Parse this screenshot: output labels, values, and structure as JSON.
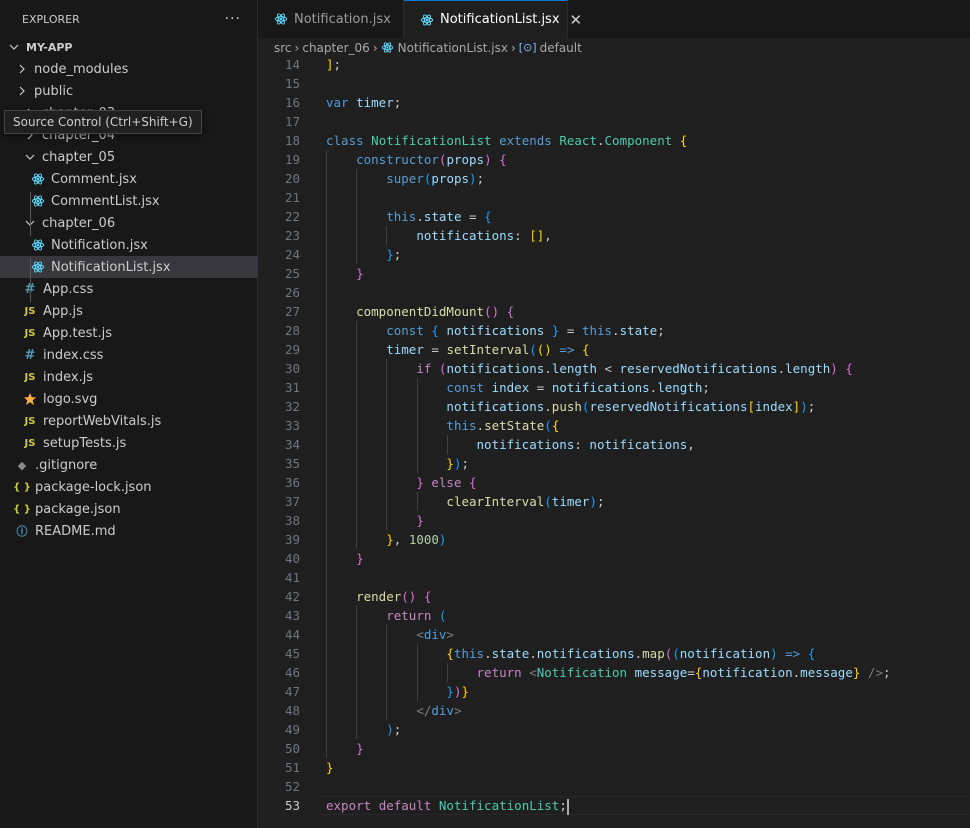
{
  "explorer": {
    "title": "EXPLORER",
    "more_actions": "···",
    "root_label": "MY-APP",
    "tooltip": "Source Control (Ctrl+Shift+G)",
    "items": [
      {
        "label": "node_modules",
        "kind": "folder-collapsed",
        "depth": 1
      },
      {
        "label": "public",
        "kind": "folder-collapsed",
        "depth": 1
      },
      {
        "label": "chapter_03",
        "kind": "folder-collapsed",
        "depth": 2
      },
      {
        "label": "chapter_04",
        "kind": "folder-collapsed",
        "depth": 2
      },
      {
        "label": "chapter_05",
        "kind": "folder-expanded",
        "depth": 2
      },
      {
        "label": "Comment.jsx",
        "kind": "react",
        "depth": 3
      },
      {
        "label": "CommentList.jsx",
        "kind": "react",
        "depth": 3
      },
      {
        "label": "chapter_06",
        "kind": "folder-expanded",
        "depth": 2
      },
      {
        "label": "Notification.jsx",
        "kind": "react",
        "depth": 3
      },
      {
        "label": "NotificationList.jsx",
        "kind": "react",
        "depth": 3,
        "selected": true
      },
      {
        "label": "App.css",
        "kind": "css",
        "depth": 2
      },
      {
        "label": "App.js",
        "kind": "js",
        "depth": 2
      },
      {
        "label": "App.test.js",
        "kind": "js",
        "depth": 2
      },
      {
        "label": "index.css",
        "kind": "css",
        "depth": 2
      },
      {
        "label": "index.js",
        "kind": "js",
        "depth": 2
      },
      {
        "label": "logo.svg",
        "kind": "svg",
        "depth": 2
      },
      {
        "label": "reportWebVitals.js",
        "kind": "js",
        "depth": 2
      },
      {
        "label": "setupTests.js",
        "kind": "js",
        "depth": 2
      },
      {
        "label": ".gitignore",
        "kind": "git",
        "depth": 1
      },
      {
        "label": "package-lock.json",
        "kind": "json",
        "depth": 1
      },
      {
        "label": "package.json",
        "kind": "json",
        "depth": 1
      },
      {
        "label": "README.md",
        "kind": "info",
        "depth": 1
      }
    ]
  },
  "tabs": [
    {
      "label": "Notification.jsx",
      "active": false
    },
    {
      "label": "NotificationList.jsx",
      "active": true
    }
  ],
  "tab_close_glyph": "✕",
  "breadcrumb": {
    "segments": [
      "src",
      "chapter_06",
      "NotificationList.jsx",
      "default"
    ]
  },
  "editor": {
    "current_line": 53,
    "lines": [
      {
        "n": 14,
        "indent": 0,
        "tokens": [
          [
            "b1",
            "]"
          ],
          [
            "pl",
            ";"
          ]
        ]
      },
      {
        "n": 15,
        "indent": 0,
        "tokens": []
      },
      {
        "n": 16,
        "indent": 0,
        "tokens": [
          [
            "kw",
            "var"
          ],
          [
            "pl",
            " "
          ],
          [
            "var",
            "timer"
          ],
          [
            "pl",
            ";"
          ]
        ]
      },
      {
        "n": 17,
        "indent": 0,
        "tokens": []
      },
      {
        "n": 18,
        "indent": 0,
        "tokens": [
          [
            "kw",
            "class"
          ],
          [
            "pl",
            " "
          ],
          [
            "cls",
            "NotificationList"
          ],
          [
            "pl",
            " "
          ],
          [
            "kw",
            "extends"
          ],
          [
            "pl",
            " "
          ],
          [
            "cls",
            "React"
          ],
          [
            "pl",
            "."
          ],
          [
            "cls",
            "Component"
          ],
          [
            "pl",
            " "
          ],
          [
            "b1",
            "{"
          ]
        ]
      },
      {
        "n": 19,
        "indent": 1,
        "tokens": [
          [
            "kw",
            "constructor"
          ],
          [
            "b2",
            "("
          ],
          [
            "var",
            "props"
          ],
          [
            "b2",
            ")"
          ],
          [
            "pl",
            " "
          ],
          [
            "b2",
            "{"
          ]
        ]
      },
      {
        "n": 20,
        "indent": 2,
        "tokens": [
          [
            "kw",
            "super"
          ],
          [
            "b3",
            "("
          ],
          [
            "var",
            "props"
          ],
          [
            "b3",
            ")"
          ],
          [
            "pl",
            ";"
          ]
        ]
      },
      {
        "n": 21,
        "indent": 0,
        "tokens": []
      },
      {
        "n": 22,
        "indent": 2,
        "tokens": [
          [
            "kw",
            "this"
          ],
          [
            "pl",
            "."
          ],
          [
            "var",
            "state"
          ],
          [
            "pl",
            " = "
          ],
          [
            "b3",
            "{"
          ]
        ]
      },
      {
        "n": 23,
        "indent": 3,
        "tokens": [
          [
            "var",
            "notifications"
          ],
          [
            "pl",
            ": "
          ],
          [
            "b1",
            "[]"
          ],
          [
            "pl",
            ","
          ]
        ]
      },
      {
        "n": 24,
        "indent": 2,
        "tokens": [
          [
            "b3",
            "}"
          ],
          [
            "pl",
            ";"
          ]
        ]
      },
      {
        "n": 25,
        "indent": 1,
        "tokens": [
          [
            "b2",
            "}"
          ]
        ]
      },
      {
        "n": 26,
        "indent": 0,
        "tokens": []
      },
      {
        "n": 27,
        "indent": 1,
        "tokens": [
          [
            "fn",
            "componentDidMount"
          ],
          [
            "b2",
            "()"
          ],
          [
            "pl",
            " "
          ],
          [
            "b2",
            "{"
          ]
        ]
      },
      {
        "n": 28,
        "indent": 2,
        "tokens": [
          [
            "kw",
            "const"
          ],
          [
            "pl",
            " "
          ],
          [
            "b3",
            "{"
          ],
          [
            "pl",
            " "
          ],
          [
            "var",
            "notifications"
          ],
          [
            "pl",
            " "
          ],
          [
            "b3",
            "}"
          ],
          [
            "pl",
            " = "
          ],
          [
            "kw",
            "this"
          ],
          [
            "pl",
            "."
          ],
          [
            "var",
            "state"
          ],
          [
            "pl",
            ";"
          ]
        ]
      },
      {
        "n": 29,
        "indent": 2,
        "tokens": [
          [
            "var",
            "timer"
          ],
          [
            "pl",
            " = "
          ],
          [
            "fn",
            "setInterval"
          ],
          [
            "b3",
            "("
          ],
          [
            "b1",
            "()"
          ],
          [
            "pl",
            " "
          ],
          [
            "kw",
            "=>"
          ],
          [
            "pl",
            " "
          ],
          [
            "b1",
            "{"
          ]
        ]
      },
      {
        "n": 30,
        "indent": 3,
        "tokens": [
          [
            "ctl",
            "if"
          ],
          [
            "pl",
            " "
          ],
          [
            "b2",
            "("
          ],
          [
            "var",
            "notifications"
          ],
          [
            "pl",
            "."
          ],
          [
            "var",
            "length"
          ],
          [
            "pl",
            " < "
          ],
          [
            "var",
            "reservedNotifications"
          ],
          [
            "pl",
            "."
          ],
          [
            "var",
            "length"
          ],
          [
            "b2",
            ")"
          ],
          [
            "pl",
            " "
          ],
          [
            "b2",
            "{"
          ]
        ]
      },
      {
        "n": 31,
        "indent": 4,
        "tokens": [
          [
            "kw",
            "const"
          ],
          [
            "pl",
            " "
          ],
          [
            "var",
            "index"
          ],
          [
            "pl",
            " = "
          ],
          [
            "var",
            "notifications"
          ],
          [
            "pl",
            "."
          ],
          [
            "var",
            "length"
          ],
          [
            "pl",
            ";"
          ]
        ]
      },
      {
        "n": 32,
        "indent": 4,
        "tokens": [
          [
            "var",
            "notifications"
          ],
          [
            "pl",
            "."
          ],
          [
            "fn",
            "push"
          ],
          [
            "b3",
            "("
          ],
          [
            "var",
            "reservedNotifications"
          ],
          [
            "b1",
            "["
          ],
          [
            "var",
            "index"
          ],
          [
            "b1",
            "]"
          ],
          [
            "b3",
            ")"
          ],
          [
            "pl",
            ";"
          ]
        ]
      },
      {
        "n": 33,
        "indent": 4,
        "tokens": [
          [
            "kw",
            "this"
          ],
          [
            "pl",
            "."
          ],
          [
            "fn",
            "setState"
          ],
          [
            "b3",
            "("
          ],
          [
            "b1",
            "{"
          ]
        ]
      },
      {
        "n": 34,
        "indent": 5,
        "tokens": [
          [
            "var",
            "notifications"
          ],
          [
            "pl",
            ": "
          ],
          [
            "var",
            "notifications"
          ],
          [
            "pl",
            ","
          ]
        ]
      },
      {
        "n": 35,
        "indent": 4,
        "tokens": [
          [
            "b1",
            "}"
          ],
          [
            "b3",
            ")"
          ],
          [
            "pl",
            ";"
          ]
        ]
      },
      {
        "n": 36,
        "indent": 3,
        "tokens": [
          [
            "b2",
            "}"
          ],
          [
            "pl",
            " "
          ],
          [
            "ctl",
            "else"
          ],
          [
            "pl",
            " "
          ],
          [
            "b2",
            "{"
          ]
        ]
      },
      {
        "n": 37,
        "indent": 4,
        "tokens": [
          [
            "fn",
            "clearInterval"
          ],
          [
            "b3",
            "("
          ],
          [
            "var",
            "timer"
          ],
          [
            "b3",
            ")"
          ],
          [
            "pl",
            ";"
          ]
        ]
      },
      {
        "n": 38,
        "indent": 3,
        "tokens": [
          [
            "b2",
            "}"
          ]
        ]
      },
      {
        "n": 39,
        "indent": 2,
        "tokens": [
          [
            "b1",
            "}"
          ],
          [
            "pl",
            ", "
          ],
          [
            "num",
            "1000"
          ],
          [
            "b3",
            ")"
          ]
        ]
      },
      {
        "n": 40,
        "indent": 1,
        "tokens": [
          [
            "b2",
            "}"
          ]
        ]
      },
      {
        "n": 41,
        "indent": 0,
        "tokens": []
      },
      {
        "n": 42,
        "indent": 1,
        "tokens": [
          [
            "fn",
            "render"
          ],
          [
            "b2",
            "()"
          ],
          [
            "pl",
            " "
          ],
          [
            "b2",
            "{"
          ]
        ]
      },
      {
        "n": 43,
        "indent": 2,
        "tokens": [
          [
            "ctl",
            "return"
          ],
          [
            "pl",
            " "
          ],
          [
            "b3",
            "("
          ]
        ]
      },
      {
        "n": 44,
        "indent": 3,
        "tokens": [
          [
            "tag",
            "<"
          ],
          [
            "kw",
            "div"
          ],
          [
            "tag",
            ">"
          ]
        ]
      },
      {
        "n": 45,
        "indent": 4,
        "tokens": [
          [
            "b1",
            "{"
          ],
          [
            "kw",
            "this"
          ],
          [
            "pl",
            "."
          ],
          [
            "var",
            "state"
          ],
          [
            "pl",
            "."
          ],
          [
            "var",
            "notifications"
          ],
          [
            "pl",
            "."
          ],
          [
            "fn",
            "map"
          ],
          [
            "b2",
            "("
          ],
          [
            "b3",
            "("
          ],
          [
            "var",
            "notification"
          ],
          [
            "b3",
            ")"
          ],
          [
            "pl",
            " "
          ],
          [
            "kw",
            "=>"
          ],
          [
            "pl",
            " "
          ],
          [
            "b3",
            "{"
          ]
        ]
      },
      {
        "n": 46,
        "indent": 5,
        "tokens": [
          [
            "ctl",
            "return"
          ],
          [
            "pl",
            " "
          ],
          [
            "tag",
            "<"
          ],
          [
            "cls",
            "Notification"
          ],
          [
            "pl",
            " "
          ],
          [
            "var",
            "message"
          ],
          [
            "pl",
            "="
          ],
          [
            "b1",
            "{"
          ],
          [
            "var",
            "notification"
          ],
          [
            "pl",
            "."
          ],
          [
            "var",
            "message"
          ],
          [
            "b1",
            "}"
          ],
          [
            "pl",
            " "
          ],
          [
            "tag",
            "/>"
          ],
          [
            "pl",
            ";"
          ]
        ]
      },
      {
        "n": 47,
        "indent": 4,
        "tokens": [
          [
            "b3",
            "}"
          ],
          [
            "b2",
            ")"
          ],
          [
            "b1",
            "}"
          ]
        ]
      },
      {
        "n": 48,
        "indent": 3,
        "tokens": [
          [
            "tag",
            "</"
          ],
          [
            "kw",
            "div"
          ],
          [
            "tag",
            ">"
          ]
        ]
      },
      {
        "n": 49,
        "indent": 2,
        "tokens": [
          [
            "b3",
            ")"
          ],
          [
            "pl",
            ";"
          ]
        ]
      },
      {
        "n": 50,
        "indent": 1,
        "tokens": [
          [
            "b2",
            "}"
          ]
        ]
      },
      {
        "n": 51,
        "indent": 0,
        "tokens": [
          [
            "b1",
            "}"
          ]
        ]
      },
      {
        "n": 52,
        "indent": 0,
        "tokens": []
      },
      {
        "n": 53,
        "indent": 0,
        "tokens": [
          [
            "ctl",
            "export"
          ],
          [
            "pl",
            " "
          ],
          [
            "ctl",
            "default"
          ],
          [
            "pl",
            " "
          ],
          [
            "cls",
            "NotificationList"
          ],
          [
            "pl",
            ";"
          ]
        ]
      }
    ]
  },
  "colors": {
    "accent": "#0078d4",
    "react_icon": "#61dafb",
    "svg_icon": "#ffb13b"
  }
}
